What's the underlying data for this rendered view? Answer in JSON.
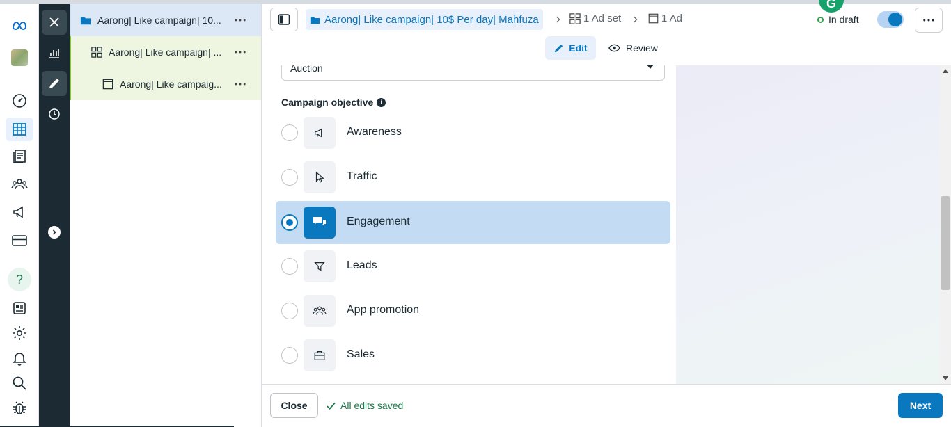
{
  "tree": {
    "campaign_label": "Aarong| Like campaign| 10...",
    "adset_label": "Aarong| Like campaign| ...",
    "ad_label": "Aarong| Like campaig..."
  },
  "breadcrumb": {
    "campaign": "Aarong| Like campaign| 10$ Per day| Mahfuza",
    "adset": "1 Ad set",
    "ad": "1 Ad"
  },
  "header": {
    "status": "In draft",
    "status_color": "#31a24c",
    "extension_badge": "G"
  },
  "modes": {
    "edit": "Edit",
    "review": "Review"
  },
  "form": {
    "buying_type_value": "Auction",
    "objective_title": "Campaign objective",
    "info_glyph": "i",
    "options": [
      {
        "label": "Awareness",
        "icon": "megaphone-icon",
        "selected": false
      },
      {
        "label": "Traffic",
        "icon": "cursor-icon",
        "selected": false
      },
      {
        "label": "Engagement",
        "icon": "chat-bubbles-icon",
        "selected": true
      },
      {
        "label": "Leads",
        "icon": "funnel-icon",
        "selected": false
      },
      {
        "label": "App promotion",
        "icon": "people-icon",
        "selected": false
      },
      {
        "label": "Sales",
        "icon": "shopping-bag-icon",
        "selected": false
      }
    ]
  },
  "footer": {
    "close": "Close",
    "saved": "All edits saved",
    "next": "Next"
  },
  "rail": {
    "help_glyph": "?"
  },
  "colors": {
    "accent": "#0a78be",
    "selected_bg": "#c3dcf3",
    "tool_rail": "#1c2b33",
    "success": "#1b7a4b"
  }
}
